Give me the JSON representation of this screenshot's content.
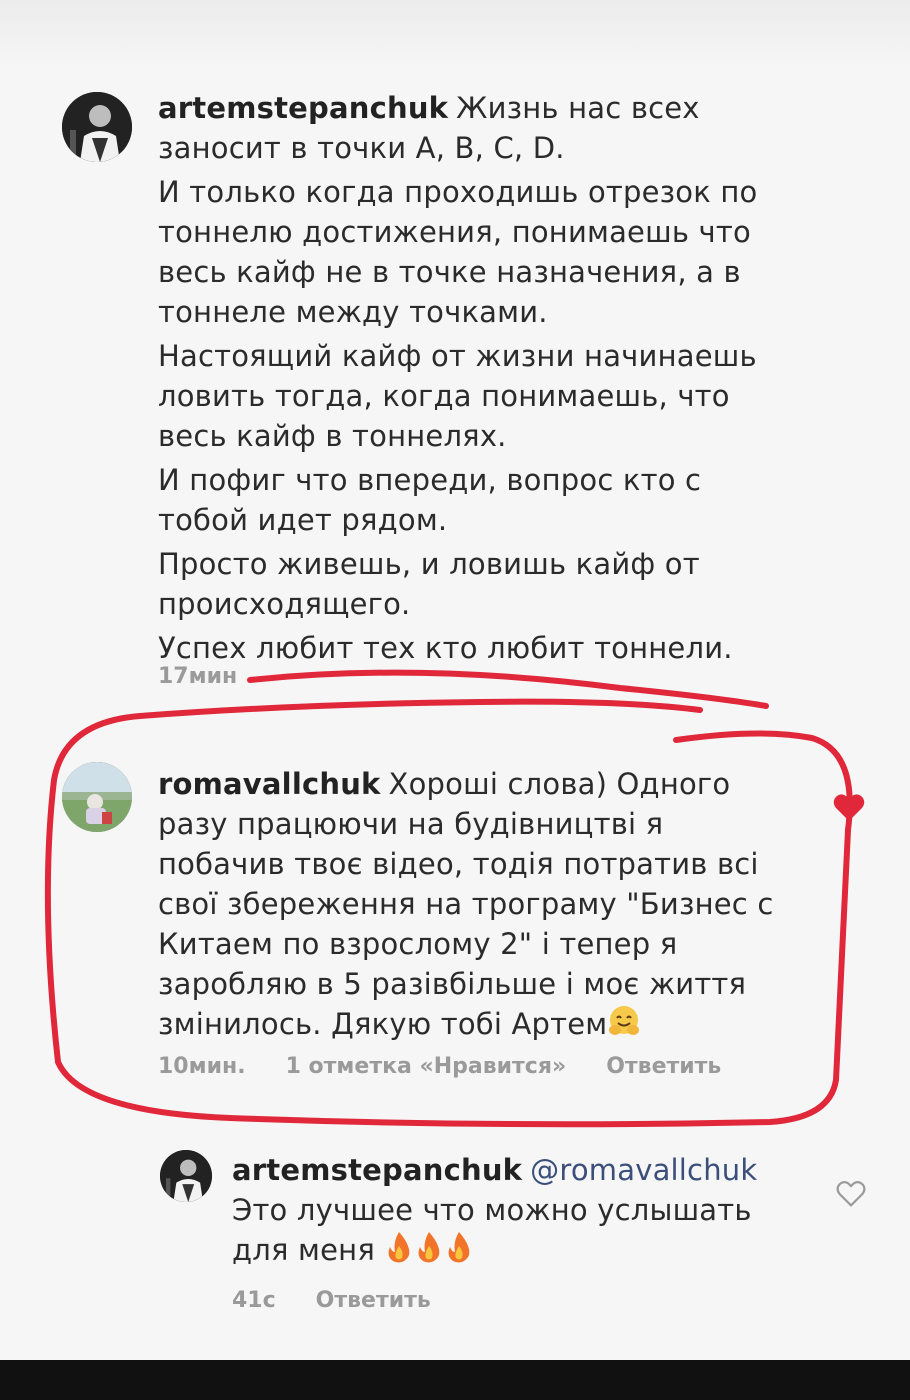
{
  "comments": [
    {
      "username": "artemstepanchuk",
      "paragraphs": [
        "Жизнь нас всех заносит в точки A, B, C, D.",
        "И только когда проходишь отрезок по тоннелю достижения, понимаешь что весь кайф не в точке назначения, а в тоннеле между точками.",
        "Настоящий кайф от жизни начинаешь ловить тогда, когда понимаешь, что весь кайф в тоннелях.",
        "И пофиг что впереди, вопрос кто с тобой идет рядом.",
        "Просто живешь, и ловишь кайф от происходящего.",
        "Успех любит тех кто любит тоннели."
      ],
      "time": "17мин"
    },
    {
      "username": "romavallchuk",
      "text": "Хороші слова) Одного разу працюючи на будівництві я побачив твоє відео, тодія потратив всі свої збереження на трограму \"Бизнес с Китаем по взрослому 2\" і тепер я заробляю в 5 разівбільше і моє життя змінилось. Дякую тобі Артем",
      "emoji": "hugging-face",
      "time": "10мин.",
      "likes": "1 отметка «Нравится»",
      "reply": "Ответить",
      "liked": true
    },
    {
      "username": "artemstepanchuk",
      "mention": "@romavallchuk",
      "text": "Это лучшее что можно услышать для меня",
      "emoji": [
        "fire",
        "fire",
        "fire"
      ],
      "time": "41с",
      "reply": "Ответить",
      "liked": false
    }
  ],
  "colors": {
    "annotation": "#e0283a",
    "meta_text": "#9a9a9a",
    "body_text": "#2b2b2b",
    "liked_heart": "#e0283a"
  }
}
